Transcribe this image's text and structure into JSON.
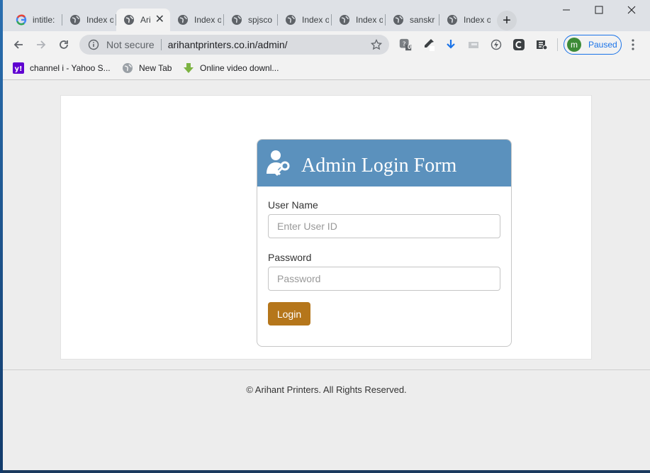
{
  "tabs": [
    {
      "label": "intitle:",
      "icon": "google-icon",
      "active": false
    },
    {
      "label": "Index of",
      "icon": "globe-icon",
      "active": false
    },
    {
      "label": "Ari",
      "icon": "globe-icon",
      "active": true
    },
    {
      "label": "Index of",
      "icon": "globe-icon",
      "active": false
    },
    {
      "label": "spjsco",
      "icon": "globe-icon",
      "active": false
    },
    {
      "label": "Index of",
      "icon": "globe-icon",
      "active": false
    },
    {
      "label": "Index of",
      "icon": "globe-icon",
      "active": false
    },
    {
      "label": "sanskr",
      "icon": "globe-icon",
      "active": false
    },
    {
      "label": "Index of",
      "icon": "globe-icon",
      "active": false
    }
  ],
  "toolbar": {
    "security_label": "Not secure",
    "url": "arihantprinters.co.in/admin/",
    "extension_badge": "0",
    "profile_initial": "m",
    "profile_status": "Paused"
  },
  "bookmarks": [
    {
      "label": "channel i - Yahoo S...",
      "icon": "yahoo-icon"
    },
    {
      "label": "New Tab",
      "icon": "globe-icon"
    },
    {
      "label": "Online video downl...",
      "icon": "download-arrow-icon"
    }
  ],
  "login": {
    "title": "Admin Login Form",
    "username_label": "User Name",
    "username_placeholder": "Enter User ID",
    "password_label": "Password",
    "password_placeholder": "Password",
    "submit_label": "Login"
  },
  "footer": {
    "text": "© Arihant Printers. All Rights Reserved."
  },
  "colors": {
    "header_blue": "#5b91bd",
    "login_button": "#b5761b",
    "profile_accent": "#1a73e8"
  }
}
